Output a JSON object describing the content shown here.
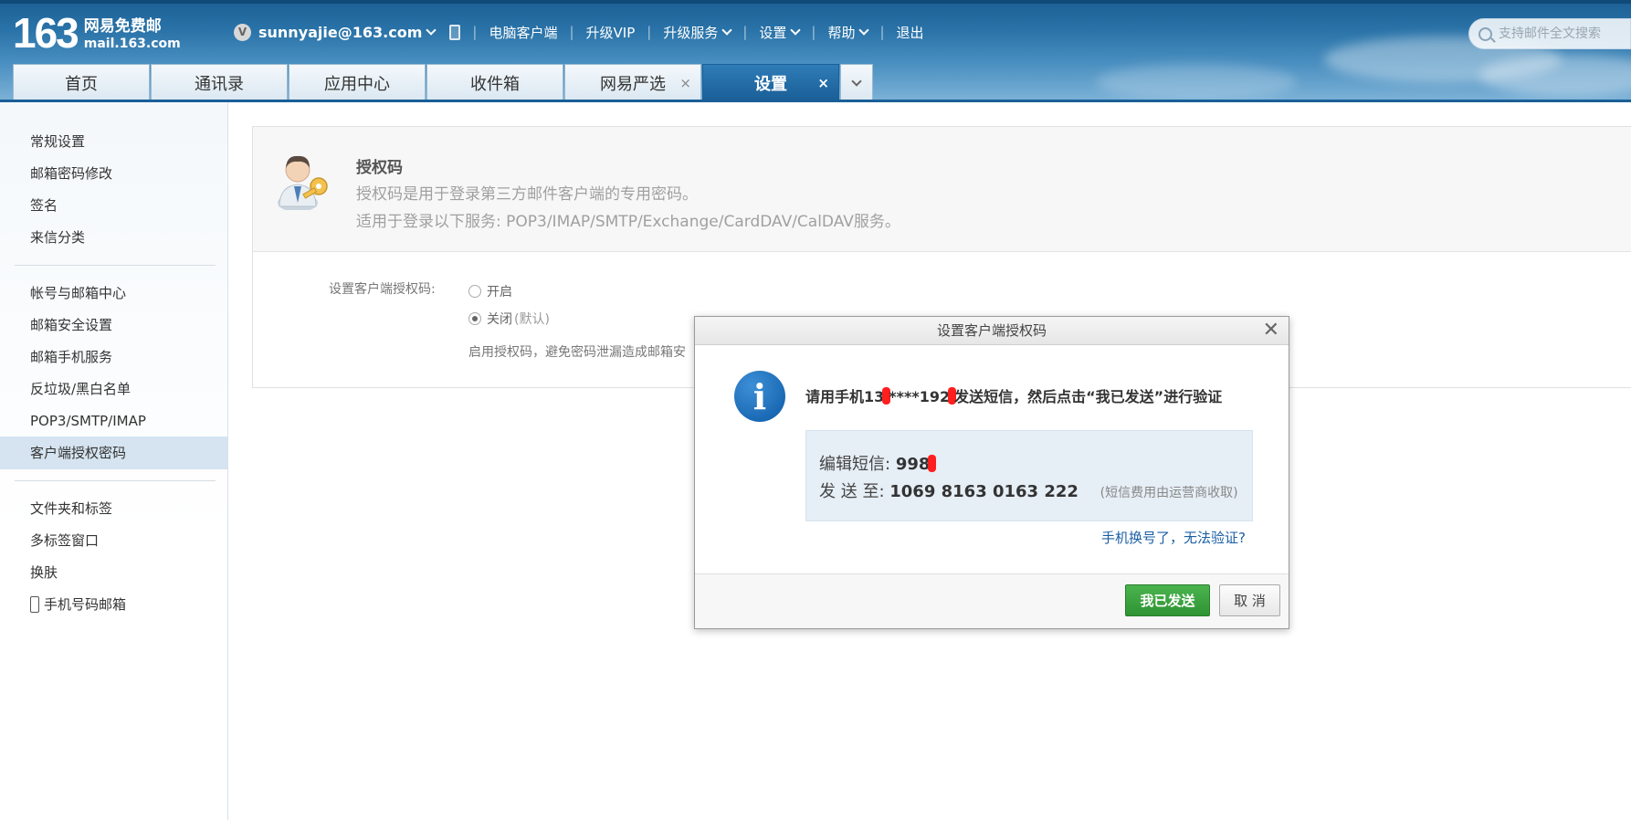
{
  "header": {
    "logo_number": "163",
    "logo_cn": "网易免费邮",
    "logo_domain": "mail.163.com",
    "vip_badge": "V",
    "account": "sunnyajie@163.com",
    "links": [
      "电脑客户端",
      "升级VIP",
      "升级服务",
      "设置",
      "帮助",
      "退出"
    ],
    "search_placeholder": "支持邮件全文搜索"
  },
  "tabs": [
    {
      "label": "首页"
    },
    {
      "label": "通讯录"
    },
    {
      "label": "应用中心"
    },
    {
      "label": "收件箱"
    },
    {
      "label": "网易严选",
      "close": "×"
    },
    {
      "label": "设置",
      "close": "×",
      "active": true
    }
  ],
  "sidebar": {
    "group1": [
      "常规设置",
      "邮箱密码修改",
      "签名",
      "来信分类"
    ],
    "group2": [
      "帐号与邮箱中心",
      "邮箱安全设置",
      "邮箱手机服务",
      "反垃圾/黑白名单",
      "POP3/SMTP/IMAP",
      "客户端授权密码"
    ],
    "group3": [
      "文件夹和标签",
      "多标签窗口",
      "换肤",
      "手机号码邮箱"
    ],
    "active": "客户端授权密码"
  },
  "panel": {
    "title": "授权码",
    "desc1": "授权码是用于登录第三方邮件客户端的专用密码。",
    "desc2": "适用于登录以下服务: POP3/IMAP/SMTP/Exchange/CardDAV/CalDAV服务。",
    "option_label": "设置客户端授权码:",
    "radio_on": "开启",
    "radio_off": "关闭",
    "radio_off_hint": "(默认)",
    "note": "启用授权码，避免密码泄漏造成邮箱安"
  },
  "dialog": {
    "title": "设置客户端授权码",
    "close": "✕",
    "info_glyph": "i",
    "msg_a": "请用手机13",
    "msg_b": "****192",
    "msg_c": "发送短信，然后点击“我已发送”进行验证",
    "sms_label": "编辑短信:",
    "sms_value": "998",
    "to_label": "发 送 至:",
    "to_value": "1069 8163 0163 222",
    "fee_note": "(短信费用由运营商收取)",
    "link": "手机换号了，无法验证?",
    "btn_ok": "我已发送",
    "btn_cancel": "取 消"
  },
  "colors": {
    "header_blue": "#2a73a8",
    "active_tab": "#1a5f97",
    "ok_green": "#3aa33e",
    "link_blue": "#1b5fa5",
    "redaction": "#ff1f1f"
  }
}
